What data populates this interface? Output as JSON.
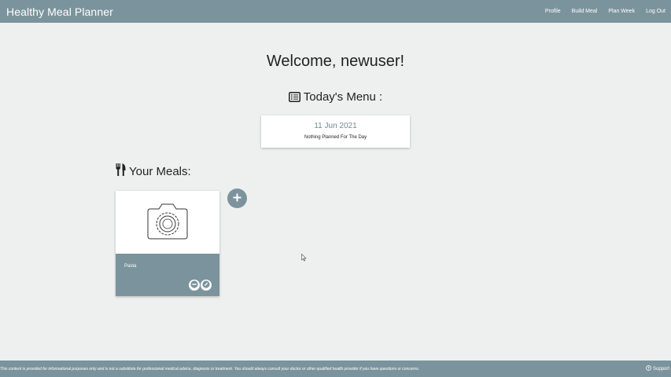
{
  "navbar": {
    "brand": "Healthy Meal Planner",
    "links": [
      "Profile",
      "Build Meal",
      "Plan Week",
      "Log Out"
    ]
  },
  "main": {
    "welcome": "Welcome, newuser!",
    "todays_menu_heading": "Today's Menu :",
    "menu_card": {
      "date": "11 Jun 2021",
      "note": "Nothing Planned For The Day"
    },
    "meals_heading": "Your Meals:",
    "meals": [
      {
        "name": "Pasta"
      }
    ]
  },
  "footer": {
    "disclaimer": "This content is provided for informational purposes only and is not a substitute for professional medical advice, diagnosis or treatment. You should always consult your doctor or other qualified health provider if you have questions or concerns.",
    "support": "Support"
  },
  "icons": {
    "menu_list": "list-alt-icon",
    "utensils": "utensils-icon",
    "add": "plus-icon",
    "remove": "minus-icon",
    "edit": "pencil-icon",
    "photo_placeholder": "camera-icon",
    "support": "question-circle-icon"
  },
  "colors": {
    "primary": "#7b939c",
    "background": "#eef0f0",
    "date_text": "#6f8c96"
  }
}
